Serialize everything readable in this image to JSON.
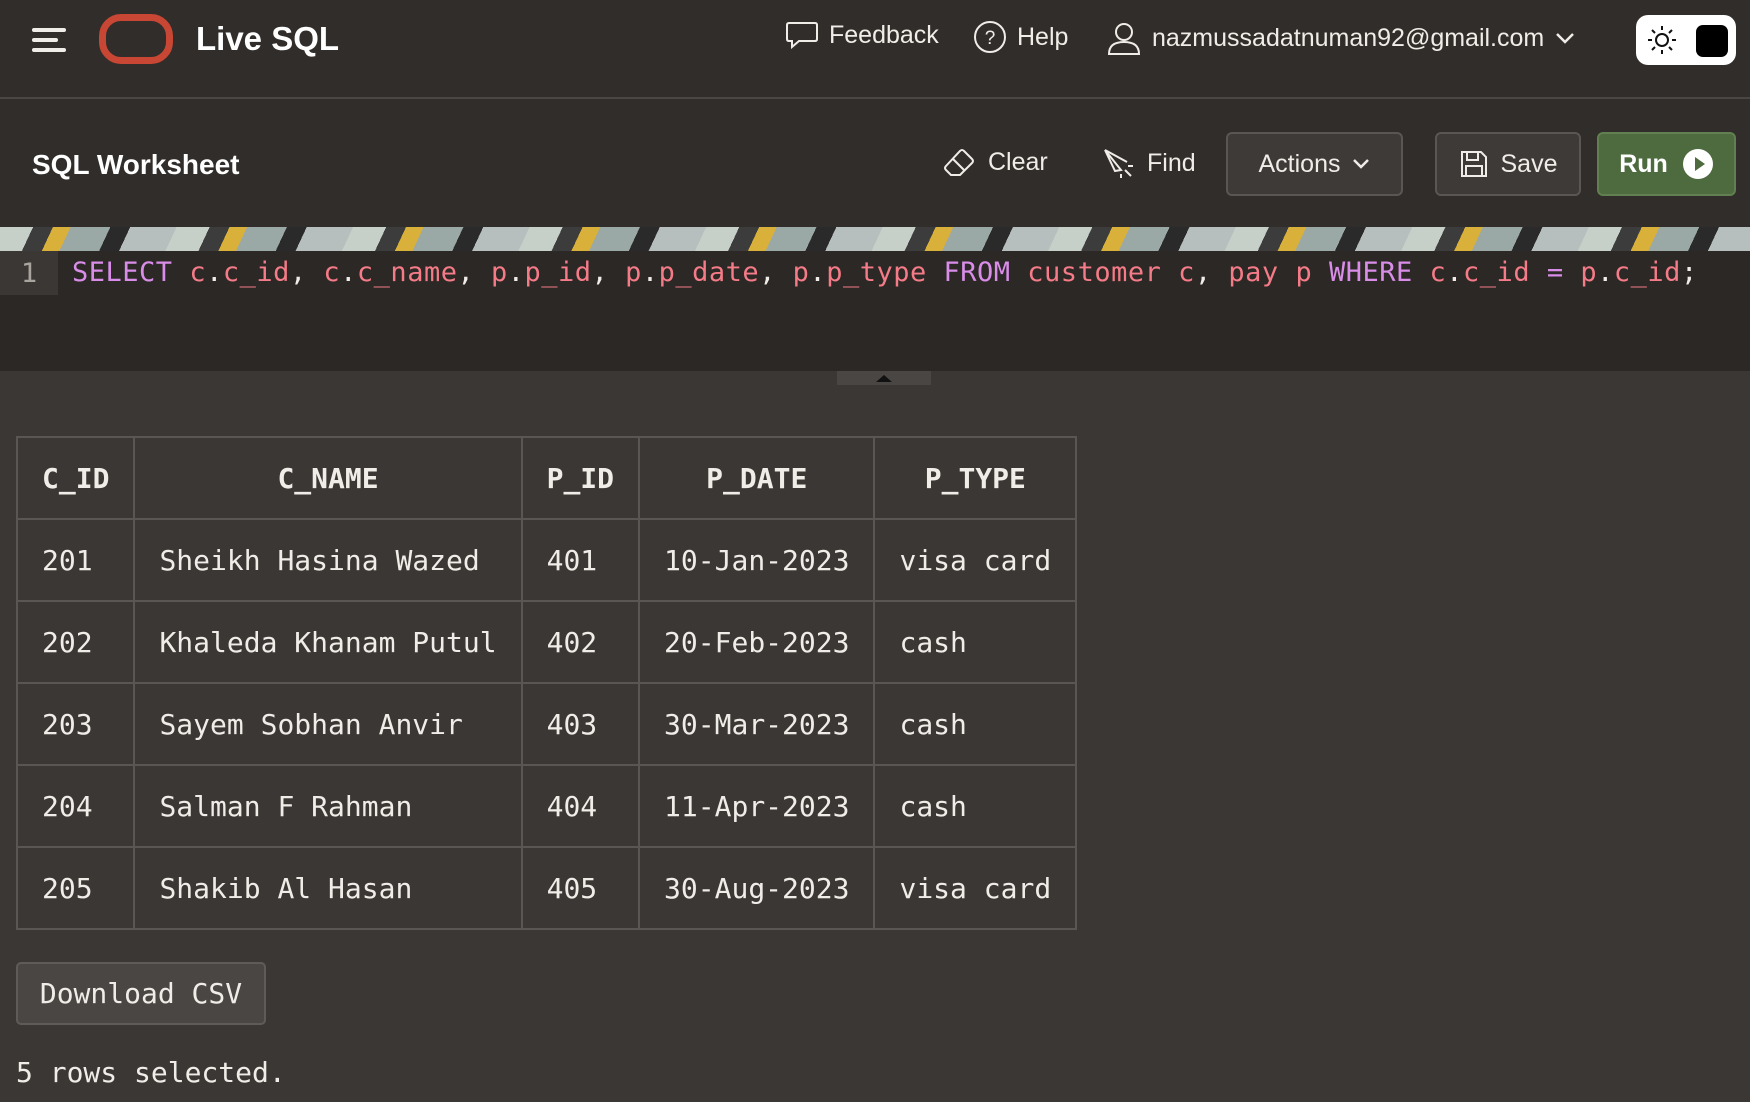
{
  "header": {
    "app_title": "Live SQL",
    "feedback_label": "Feedback",
    "help_label": "Help",
    "user_email": "nazmussadatnuman92@gmail.com",
    "icons": [
      "menu-icon",
      "oracle-logo",
      "feedback-icon",
      "help-icon",
      "user-icon",
      "chevron-down-icon",
      "sun-icon"
    ],
    "brand_color": "#c74634"
  },
  "toolbar": {
    "title": "SQL Worksheet",
    "clear_label": "Clear",
    "find_label": "Find",
    "actions_label": "Actions",
    "save_label": "Save",
    "run_label": "Run",
    "run_color": "#4d6b3e"
  },
  "editor": {
    "line_number": "1",
    "tokens": [
      {
        "t": "SELECT",
        "c": "kw"
      },
      {
        "t": " ",
        "c": ""
      },
      {
        "t": "c",
        "c": "id"
      },
      {
        "t": ".",
        "c": ""
      },
      {
        "t": "c_id",
        "c": "id"
      },
      {
        "t": ", ",
        "c": ""
      },
      {
        "t": "c",
        "c": "id"
      },
      {
        "t": ".",
        "c": ""
      },
      {
        "t": "c_name",
        "c": "id"
      },
      {
        "t": ", ",
        "c": ""
      },
      {
        "t": "p",
        "c": "id"
      },
      {
        "t": ".",
        "c": ""
      },
      {
        "t": "p_id",
        "c": "id"
      },
      {
        "t": ", ",
        "c": ""
      },
      {
        "t": "p",
        "c": "id"
      },
      {
        "t": ".",
        "c": ""
      },
      {
        "t": "p_date",
        "c": "id"
      },
      {
        "t": ", ",
        "c": ""
      },
      {
        "t": "p",
        "c": "id"
      },
      {
        "t": ".",
        "c": ""
      },
      {
        "t": "p_type",
        "c": "id"
      },
      {
        "t": " ",
        "c": ""
      },
      {
        "t": "FROM",
        "c": "kw"
      },
      {
        "t": " ",
        "c": ""
      },
      {
        "t": "customer",
        "c": "id"
      },
      {
        "t": " ",
        "c": ""
      },
      {
        "t": "c",
        "c": "id"
      },
      {
        "t": ", ",
        "c": ""
      },
      {
        "t": "pay",
        "c": "id"
      },
      {
        "t": " ",
        "c": ""
      },
      {
        "t": "p",
        "c": "id"
      },
      {
        "t": " ",
        "c": ""
      },
      {
        "t": "WHERE",
        "c": "kw"
      },
      {
        "t": " ",
        "c": ""
      },
      {
        "t": "c",
        "c": "id"
      },
      {
        "t": ".",
        "c": ""
      },
      {
        "t": "c_id",
        "c": "id"
      },
      {
        "t": " ",
        "c": ""
      },
      {
        "t": "=",
        "c": "kw"
      },
      {
        "t": " ",
        "c": ""
      },
      {
        "t": "p",
        "c": "id"
      },
      {
        "t": ".",
        "c": ""
      },
      {
        "t": "c_id",
        "c": "id"
      },
      {
        "t": ";",
        "c": ""
      }
    ],
    "keyword_color": "#d98de8",
    "identifier_color": "#f47b87"
  },
  "results": {
    "columns": [
      "C_ID",
      "C_NAME",
      "P_ID",
      "P_DATE",
      "P_TYPE"
    ],
    "rows": [
      [
        "201",
        "Sheikh Hasina Wazed",
        "401",
        "10-Jan-2023",
        "visa card"
      ],
      [
        "202",
        "Khaleda Khanam Putul",
        "402",
        "20-Feb-2023",
        "cash"
      ],
      [
        "203",
        "Sayem Sobhan Anvir",
        "403",
        "30-Mar-2023",
        "cash"
      ],
      [
        "204",
        "Salman F Rahman",
        "404",
        "11-Apr-2023",
        "cash"
      ],
      [
        "205",
        "Shakib Al Hasan",
        "405",
        "30-Aug-2023",
        "visa card"
      ]
    ],
    "download_label": "Download CSV",
    "rows_message": "5 rows selected."
  }
}
